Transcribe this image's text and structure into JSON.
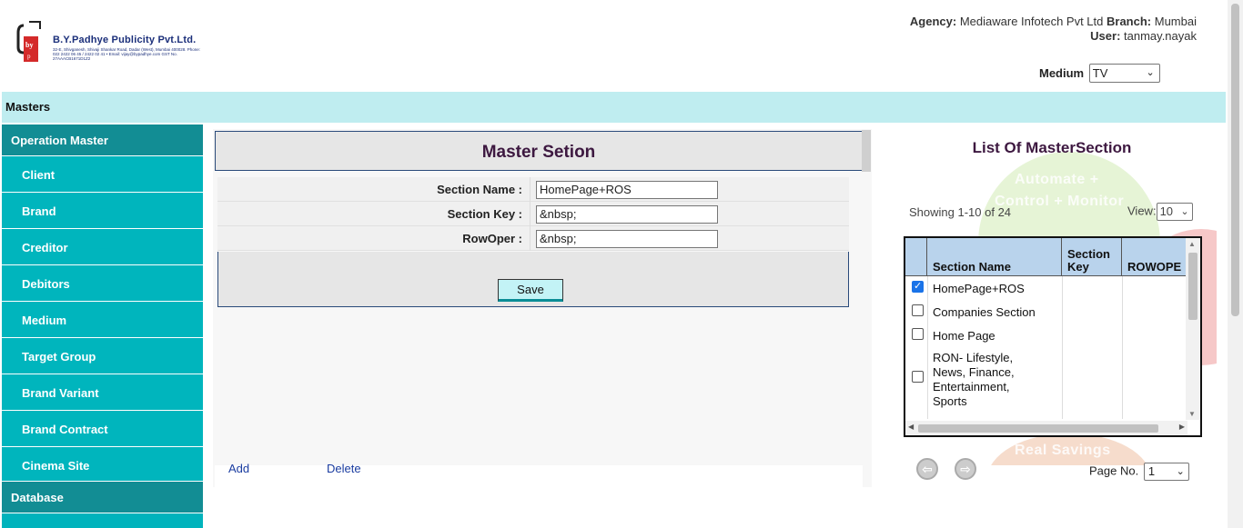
{
  "header": {
    "company_name": "B.Y.Padhye Publicity Pvt.Ltd.",
    "company_address": "32-E, Shivganesh, Shivaji Shankar Road, Dadar (West), Mumbai 400028. Phone: 022 2422 06 45 / 2422 02 41 • Email: vijay@bypadhye.com GST No. 27AAACB1671D1Z2",
    "agency_label": "Agency:",
    "agency_value": "Mediaware Infotech Pvt Ltd",
    "branch_label": "Branch:",
    "branch_value": "Mumbai",
    "user_label": "User:",
    "user_value": "tanmay.nayak",
    "medium_label": "Medium",
    "medium_value": "TV"
  },
  "masters_bar": {
    "label": "Masters"
  },
  "sidebar": {
    "heading": "Operation Master",
    "items": [
      {
        "label": "Client"
      },
      {
        "label": "Brand"
      },
      {
        "label": "Creditor"
      },
      {
        "label": "Debitors"
      },
      {
        "label": "Medium"
      },
      {
        "label": "Target Group"
      },
      {
        "label": "Brand Variant"
      },
      {
        "label": "Brand Contract"
      },
      {
        "label": "Cinema Site"
      }
    ],
    "footer_heading": "Database"
  },
  "form": {
    "title": "Master Setion",
    "fields": [
      {
        "label": "Section Name :",
        "value": "HomePage+ROS"
      },
      {
        "label": "Section Key :",
        "value": "&nbsp;"
      },
      {
        "label": "RowOper :",
        "value": "&nbsp;"
      }
    ],
    "save_label": "Save",
    "add_label": "Add",
    "delete_label": "Delete"
  },
  "list": {
    "title": "List Of MasterSection",
    "showing": "Showing 1-10 of 24",
    "view_label": "View:",
    "view_value": "10",
    "columns": [
      "Section Name",
      "Section Key",
      "ROWOPE"
    ],
    "rows": [
      {
        "name": "HomePage+ROS",
        "checked": true
      },
      {
        "name": "Companies Section",
        "checked": false
      },
      {
        "name": "Home Page",
        "checked": false
      },
      {
        "name": "RON- Lifestyle, News, Finance, Entertainment, Sports",
        "checked": false
      }
    ],
    "watermark_lines": [
      "Automate +",
      "Control + Monitor",
      "Real Savings"
    ],
    "page_label": "Page No.",
    "page_value": "1"
  },
  "colors": {
    "sidebar_bg": "#00b5bd",
    "sidebar_heading_bg": "#128d94",
    "masters_bar_bg": "#bfedf0",
    "title_color": "#3d1840",
    "link_color": "#1a3ca0"
  }
}
